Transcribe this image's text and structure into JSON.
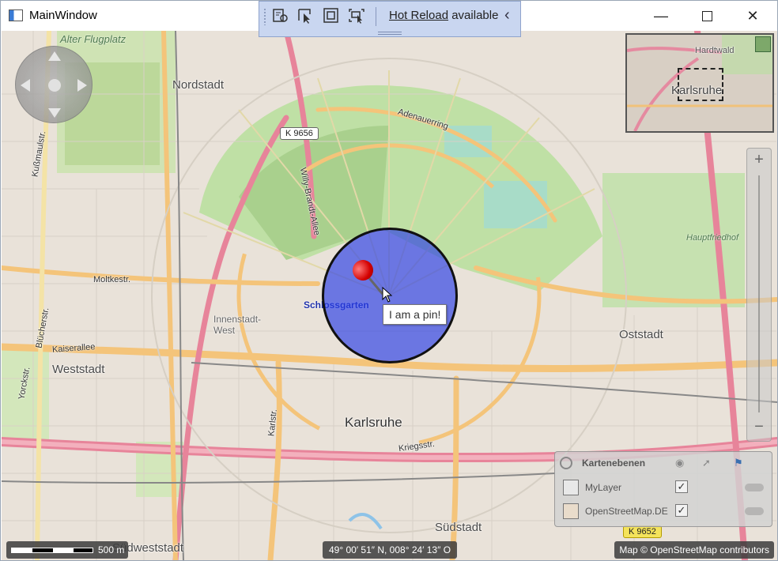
{
  "window": {
    "title": "MainWindow",
    "controls": {
      "minimize": "—",
      "maximize": "☐",
      "close": "✕"
    }
  },
  "hot_reload_toolbar": {
    "link_text": "Hot Reload",
    "status_text": "available",
    "collapse_glyph": "‹",
    "tools": [
      "live-visual-tree-icon",
      "select-element-icon",
      "display-adorners-icon",
      "track-focus-icon"
    ]
  },
  "map": {
    "places": {
      "alter_flugplatz": "Alter Flugplatz",
      "nordstadt": "Nordstadt",
      "weststadt": "Weststadt",
      "oststadt": "Oststadt",
      "karlsruhe": "Karlsruhe",
      "suedstadt": "Südstadt",
      "innenstadt_west": "Innenstadt-\nWest",
      "hauptfriedhof": "Hauptfriedhof",
      "suedweststadt": "Südweststadt",
      "schlossgarten": "Schlossgarten"
    },
    "streets": {
      "adenauerring": "Adenauerring",
      "willy_brandt_allee": "Willy-Brandt-Allee",
      "moltkestr": "Moltkestr.",
      "kaiserallee": "Kaiserallee",
      "kriegsstr": "Kriegsstr.",
      "bluecherstr": "Blücherstr.",
      "yorckstr": "Yorckstr.",
      "karlstr": "Karlstr.",
      "kussmaulstr": "Kußmaulstr."
    },
    "road_shields": {
      "k9656": "K 9656",
      "k9652": "K 9652"
    },
    "minimap": {
      "label": "Karlsruhe",
      "area": "Hardtwald"
    },
    "zoom": {
      "plus": "+",
      "minus": "−"
    },
    "pin": {
      "tooltip": "I am a pin!",
      "range_color": "#2a3ce6",
      "pin_color": "#d40000"
    },
    "layers_panel": {
      "title": "Kartenebenen",
      "layers": [
        {
          "name": "MyLayer",
          "checked": "✓"
        },
        {
          "name": "OpenStreetMap.DE",
          "checked": "✓"
        }
      ]
    },
    "scale_label": "500 m",
    "coordinates": "49° 00′ 51″ N, 008° 24′ 13″ O",
    "attribution": "Map © OpenStreetMap contributors"
  }
}
